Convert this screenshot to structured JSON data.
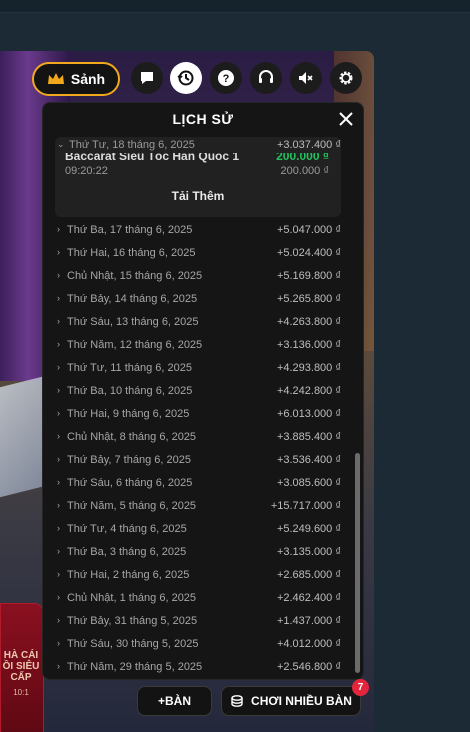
{
  "lobby": {
    "label": "Sảnh"
  },
  "toolbar": {
    "icons": [
      "chat-icon",
      "history-icon",
      "help-icon",
      "support-headset-icon",
      "sound-muted-icon",
      "settings-gear-icon"
    ]
  },
  "history": {
    "title": "LỊCH SỬ",
    "expanded": {
      "date": "Thứ Tư, 18 tháng 6, 2025",
      "total": "+3.037.400 ₫",
      "game_name": "Baccarat Siêu Tốc Hàn Quốc 1",
      "game_amount": "200.000 ₫",
      "time": "09:20:22",
      "bet": "200.000 ₫",
      "load_more": "Tải Thêm"
    },
    "rows": [
      {
        "date": "Thứ Ba, 17 tháng 6, 2025",
        "amount": "+5.047.000 ₫"
      },
      {
        "date": "Thứ Hai, 16 tháng 6, 2025",
        "amount": "+5.024.400 ₫"
      },
      {
        "date": "Chủ Nhật, 15 tháng 6, 2025",
        "amount": "+5.169.800 ₫"
      },
      {
        "date": "Thứ Bảy, 14 tháng 6, 2025",
        "amount": "+5.265.800 ₫"
      },
      {
        "date": "Thứ Sáu, 13 tháng 6, 2025",
        "amount": "+4.263.800 ₫"
      },
      {
        "date": "Thứ Năm, 12 tháng 6, 2025",
        "amount": "+3.136.000 ₫"
      },
      {
        "date": "Thứ Tư, 11 tháng 6, 2025",
        "amount": "+4.293.800 ₫"
      },
      {
        "date": "Thứ Ba, 10 tháng 6, 2025",
        "amount": "+4.242.800 ₫"
      },
      {
        "date": "Thứ Hai, 9 tháng 6, 2025",
        "amount": "+6.013.000 ₫"
      },
      {
        "date": "Chủ Nhật, 8 tháng 6, 2025",
        "amount": "+3.885.400 ₫"
      },
      {
        "date": "Thứ Bảy, 7 tháng 6, 2025",
        "amount": "+3.536.400 ₫"
      },
      {
        "date": "Thứ Sáu, 6 tháng 6, 2025",
        "amount": "+3.085.600 ₫"
      },
      {
        "date": "Thứ Năm, 5 tháng 6, 2025",
        "amount": "+15.717.000 ₫"
      },
      {
        "date": "Thứ Tư, 4 tháng 6, 2025",
        "amount": "+5.249.600 ₫"
      },
      {
        "date": "Thứ Ba, 3 tháng 6, 2025",
        "amount": "+3.135.000 ₫"
      },
      {
        "date": "Thứ Hai, 2 tháng 6, 2025",
        "amount": "+2.685.000 ₫"
      },
      {
        "date": "Chủ Nhật, 1 tháng 6, 2025",
        "amount": "+2.462.400 ₫"
      },
      {
        "date": "Thứ Bảy, 31 tháng 5, 2025",
        "amount": "+1.437.000 ₫"
      },
      {
        "date": "Thứ Sáu, 30 tháng 5, 2025",
        "amount": "+4.012.000 ₫"
      },
      {
        "date": "Thứ Năm, 29 tháng 5, 2025",
        "amount": "+2.546.800 ₫"
      }
    ]
  },
  "promo": {
    "text": "HÀ CÁI ỒI SIÊU CẤP",
    "sub": "10:1"
  },
  "bottom": {
    "add_table": "+BÀN",
    "multi_table": "CHƠI NHIỀU BÀN",
    "badge": "7"
  },
  "colors": {
    "accent": "#f2a81d",
    "win": "#21c15d",
    "badge": "#e3263c"
  }
}
